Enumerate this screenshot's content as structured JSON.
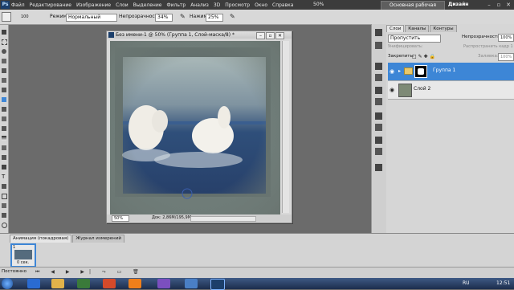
{
  "menubar": {
    "app_logo": "Ps",
    "items": [
      "Файл",
      "Редактирование",
      "Изображение",
      "Слои",
      "Выделение",
      "Фильтр",
      "Анализ",
      "3D",
      "Просмотр",
      "Окно",
      "Справка"
    ],
    "zoom": "50%",
    "workspace": "Основная рабочая среда",
    "design": "Дизайн"
  },
  "options": {
    "brush_size": "100",
    "mode_label": "Режим:",
    "mode_value": "Нормальный",
    "opacity_label": "Непрозрачность:",
    "opacity_value": "34%",
    "flow_label": "Нажим:",
    "flow_value": "25%"
  },
  "document": {
    "title": "Без имени-1 @ 50% (Группа 1, Слой-маска/8) *",
    "zoom": "50%",
    "doc_info": "Док: 2,86M/195,9M"
  },
  "layers_panel": {
    "tabs": [
      "Слои",
      "Каналы",
      "Контуры"
    ],
    "blend_mode": "Пропустить",
    "opacity_label": "Непрозрачность:",
    "opacity_value": "100%",
    "lock_label": "Закрепить:",
    "fill_label": "Заливка:",
    "fill_value": "100%",
    "unify_label": "Унифицировать:",
    "propagate_label": "Распространить кадр 1",
    "layers": [
      {
        "name": "Группа 1"
      },
      {
        "name": "Слой 2"
      }
    ]
  },
  "animation": {
    "tabs": [
      "Анимация (покадровая)",
      "Журнал измерений"
    ],
    "frame_number": "1",
    "frame_time": "0 сек.",
    "loop": "Постоянно"
  },
  "taskbar": {
    "lang": "RU",
    "time": "12:51"
  },
  "colors": {
    "selected_layer": "#3d86d6",
    "workspace_btn": "#5e5e5e"
  }
}
